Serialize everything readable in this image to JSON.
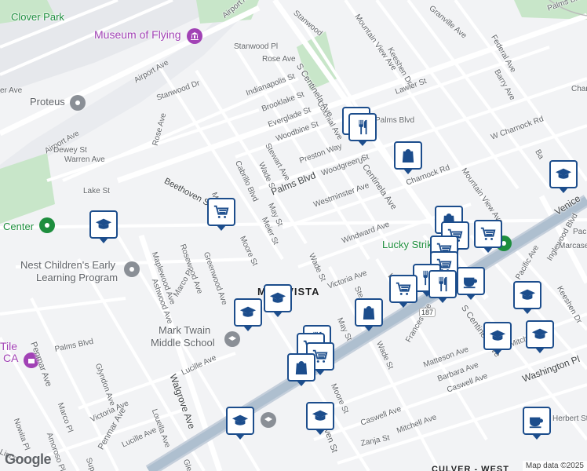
{
  "map": {
    "attribution": "Map data ©2025",
    "logo": "Google",
    "colors": {
      "land": "#f2f3f5",
      "road": "#ffffff",
      "road_outline": "#d6d8dc",
      "highway": "#aebfcf",
      "park": "#c8e6c9",
      "airport": "#e6e8ec",
      "pin_border": "#1c4d8c",
      "poi_purple": "#a142b5",
      "poi_green": "#1e8e3e"
    }
  },
  "places": {
    "clover_park": "Clover Park",
    "museum_of_flying": "Museum of Flying",
    "proteus": "Proteus",
    "center": "Center",
    "nest_line1": "Nest Children's Early",
    "nest_line2": "Learning Program",
    "mark_twain_line1": "Mark Twain",
    "mark_twain_line2": "Middle School",
    "tile_line1": "Tile",
    "tile_line2": "CA",
    "lucky_strike": "Lucky Strike",
    "mar_vista": "MAR VISTA",
    "culver_west": "CULVER - WEST"
  },
  "streets": {
    "airport_ave_top": "Airport Ave",
    "airport_ave_left": "Airport Ave",
    "airport_ave_low": "Airport Ave",
    "dewey_st": "Dewey St",
    "warren_ave": "Warren Ave",
    "lake_st": "Lake St",
    "rose_ave_left": "Rose Ave",
    "rose_ave_top": "Rose Ave",
    "stanwood_dr": "Stanwood Dr",
    "stanwood_pl": "Stanwood Pl",
    "stanwood_top": "Stanwood",
    "beethoven_st_top": "Beethoven St",
    "beethoven_st_bottom": "Beethoven St",
    "moore_st_top": "Moore St",
    "moore_st_mid": "Moore St",
    "moore_st_bottom": "Moore St",
    "meier_st": "Meier St",
    "may_st_top": "May St",
    "may_st_bottom": "May St",
    "wade_st_top": "Wade St",
    "wade_st_mid": "Wade St",
    "wade_st_bottom": "Wade St",
    "cabrillo_blvd": "Cabrillo Blvd",
    "stewart_ave": "Stewart Ave",
    "palms_blvd_mid": "Palms Blvd",
    "palms_blvd_left": "Palms Blvd",
    "palms_blvd_right": "Palms Blvd",
    "palms_blvd_topright": "Palms Blvd",
    "indianapolis_st": "Indianapolis St",
    "brooklake_st": "Brooklake St",
    "everglade_st": "Everglade St",
    "woodbine_st": "Woodbine St",
    "colonial_ave": "Colonial Ave",
    "preston_way": "Preston Way",
    "s_centinela_top": "S Centinela Ave",
    "s_centinela_mid": "S Centinela Ave",
    "s_centinela_bottom": "S Centinela Ave",
    "woodgreen_st": "Woodgreen St",
    "westminster_ave": "Westminster Ave",
    "windward_ave": "Windward Ave",
    "victoria_ave_mid": "Victoria Ave",
    "victoria_ave_left": "Victoria Ave",
    "mountain_view_top": "Mountain View Ave",
    "mountain_view_mid": "Mountain View Ave",
    "keeshen_dr_top": "Keeshen Dr",
    "keeshen_dr_right": "Keeshen Dr",
    "lawler_st": "Lawler St",
    "granville_ave": "Granville Ave",
    "federal_ave": "Federal Ave",
    "barry_ave": "Barry Ave",
    "w_charnock_rd": "W Charnock Rd",
    "charnock_rd": "Charnock Rd",
    "venice_blvd": "Venice",
    "inglewood_blvd": "Inglewood Blvd",
    "marcasel": "Marcasel",
    "pacific_ave": "Pacific Ave",
    "frances_ave": "Frances Ave",
    "matteson_ave": "Matteson Ave",
    "barbara_ave": "Barbara Ave",
    "caswell_ave_right": "Caswell Ave",
    "caswell_ave_bottom": "Caswell Ave",
    "mitchell_ave_right": "Mitchell",
    "mitchell_ave_bottom": "Mitchell Ave",
    "washington_pl": "Washington Pl",
    "zanja_st": "Zanja St",
    "herbert_st": "Herbert St",
    "maplewood_ave": "Maplewood Ave",
    "rosewood_ave": "Rosewood Ave",
    "greenwood_ave": "Greenwood Ave",
    "ashwood_ave": "Ashwood Ave",
    "marco_pl_mid": "Marco Pl",
    "marco_pl_left": "Marco Pl",
    "walgrove_ave": "Walgrove Ave",
    "lucille_ave_mid": "Lucille Ave",
    "lucille_ave_left": "Lucille Ave",
    "glyndon_ave": "Glyndon Ave",
    "louella_ave": "Louella Ave",
    "penmar_ave_left": "Penmar Ave",
    "penmar_ave_bottom": "Penmar Ave",
    "nowita_pl": "Nowita Pl",
    "amoroso_pl": "Amoroso Pl",
    "lincoln": "Lincol",
    "superba": "Superba",
    "er_ave": "er Ave",
    "route_187": "187",
    "glen": "Glen",
    "bo": "Bo",
    "ste": "Ste",
    "wa": "Wa",
    "chan": "Chan",
    "ba": "Ba",
    "pac": "Pac"
  },
  "markers": [
    {
      "type": "restaurant",
      "icon": "fork-knife-icon"
    },
    {
      "type": "shopping",
      "icon": "shopping-bag-icon"
    },
    {
      "type": "school",
      "icon": "graduation-cap-icon"
    },
    {
      "type": "grocery",
      "icon": "shopping-cart-icon"
    },
    {
      "type": "cafe",
      "icon": "coffee-cup-icon"
    }
  ]
}
